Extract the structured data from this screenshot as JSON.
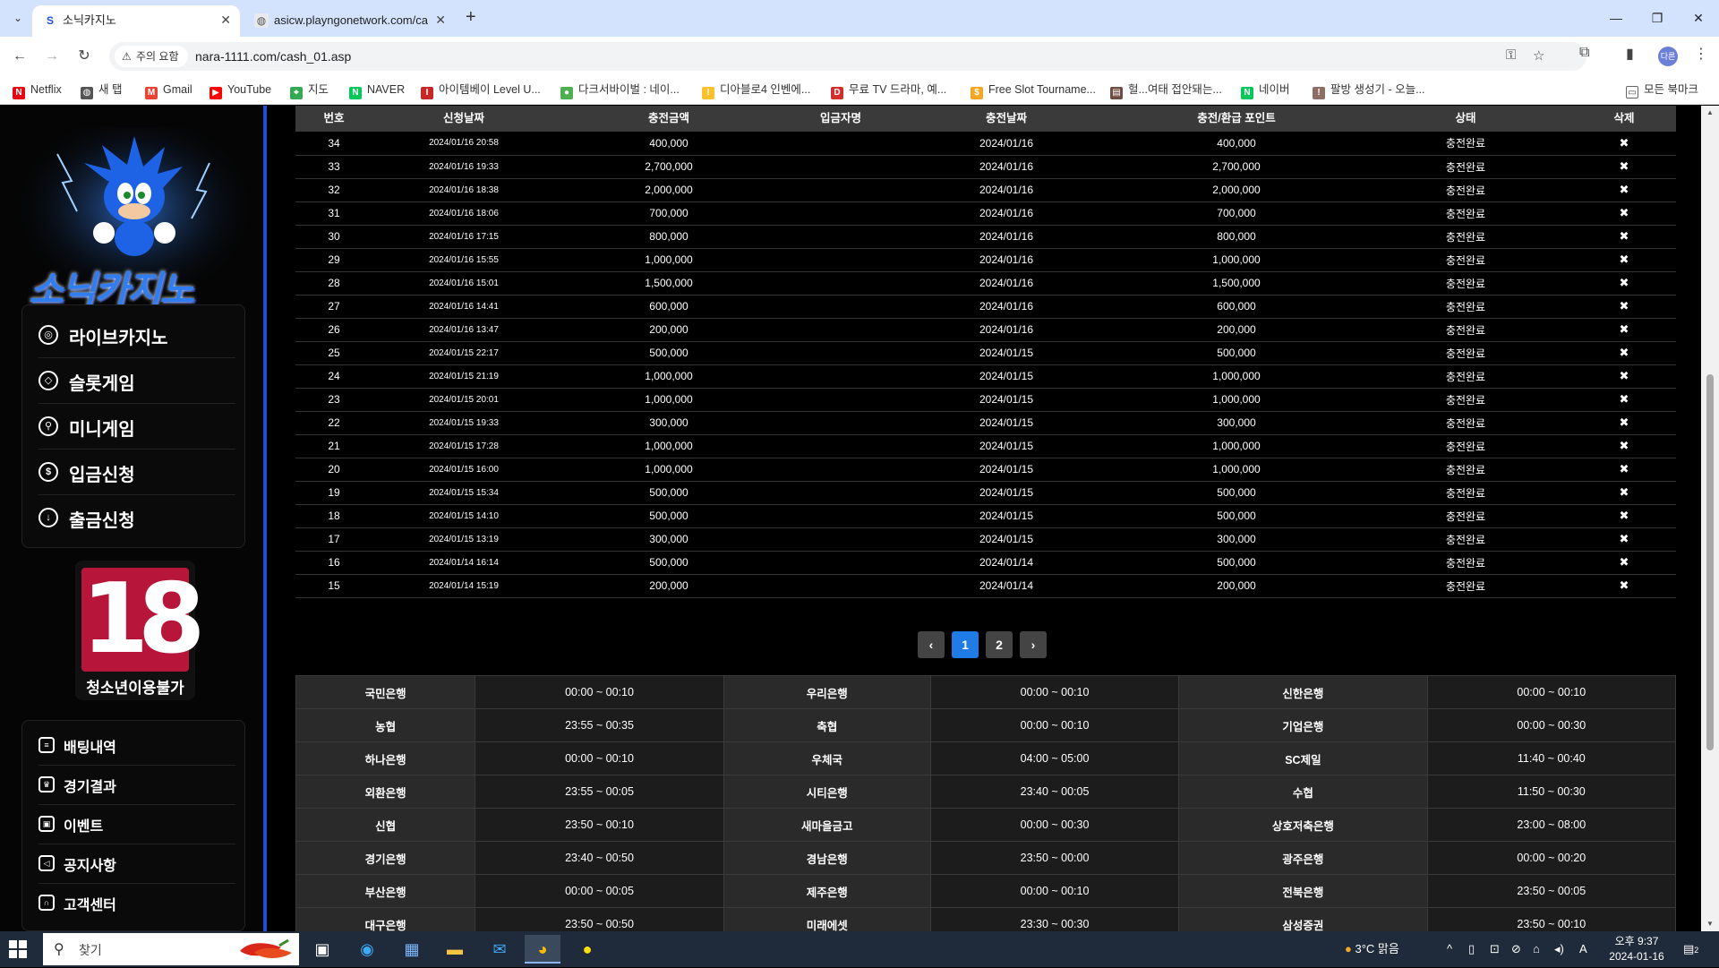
{
  "browser": {
    "tabs": [
      {
        "title": "소닉카지노",
        "active": true
      },
      {
        "title": "asicw.playngonetwork.com/ca",
        "active": false
      }
    ],
    "url": "nara-1111.com/cash_01.asp",
    "security_warning": "주의 요함",
    "bookmarks": [
      "Netflix",
      "새 탭",
      "Gmail",
      "YouTube",
      "지도",
      "NAVER",
      "아이템베이 Level U...",
      "다크서바이벌 : 네이...",
      "디아블로4 인벤에...",
      "무료 TV 드라마, 예...",
      "Free Slot Tourname...",
      "헐...여태 접안돼는...",
      "네이버",
      "팔방 생성기 - 오늘...",
      "모든 북마크"
    ],
    "profile_label": "다른"
  },
  "sidebar": {
    "logo_text": "소닉카지노",
    "main_menu": [
      {
        "label": "라이브카지노",
        "icon": "casino-chip-icon"
      },
      {
        "label": "슬롯게임",
        "icon": "diamond-icon"
      },
      {
        "label": "미니게임",
        "icon": "joystick-icon"
      },
      {
        "label": "입금신청",
        "icon": "dollar-icon"
      },
      {
        "label": "출금신청",
        "icon": "download-icon"
      }
    ],
    "age_badge": "18",
    "age_text": "청소년이용불가",
    "sub_menu": [
      {
        "label": "배팅내역",
        "icon": "list-icon"
      },
      {
        "label": "경기결과",
        "icon": "trophy-icon"
      },
      {
        "label": "이벤트",
        "icon": "gift-icon"
      },
      {
        "label": "공지사항",
        "icon": "megaphone-icon"
      },
      {
        "label": "고객센터",
        "icon": "headset-icon"
      }
    ]
  },
  "history": {
    "headers": [
      "번호",
      "신청날짜",
      "충전금액",
      "입금자명",
      "충전날짜",
      "충전/환급 포인트",
      "상태",
      "삭제"
    ],
    "rows": [
      [
        "34",
        "2024/01/16 20:58",
        "400,000",
        "",
        "2024/01/16",
        "400,000",
        "충전완료",
        "✖"
      ],
      [
        "33",
        "2024/01/16 19:33",
        "2,700,000",
        "",
        "2024/01/16",
        "2,700,000",
        "충전완료",
        "✖"
      ],
      [
        "32",
        "2024/01/16 18:38",
        "2,000,000",
        "",
        "2024/01/16",
        "2,000,000",
        "충전완료",
        "✖"
      ],
      [
        "31",
        "2024/01/16 18:06",
        "700,000",
        "",
        "2024/01/16",
        "700,000",
        "충전완료",
        "✖"
      ],
      [
        "30",
        "2024/01/16 17:15",
        "800,000",
        "",
        "2024/01/16",
        "800,000",
        "충전완료",
        "✖"
      ],
      [
        "29",
        "2024/01/16 15:55",
        "1,000,000",
        "",
        "2024/01/16",
        "1,000,000",
        "충전완료",
        "✖"
      ],
      [
        "28",
        "2024/01/16 15:01",
        "1,500,000",
        "",
        "2024/01/16",
        "1,500,000",
        "충전완료",
        "✖"
      ],
      [
        "27",
        "2024/01/16 14:41",
        "600,000",
        "",
        "2024/01/16",
        "600,000",
        "충전완료",
        "✖"
      ],
      [
        "26",
        "2024/01/16 13:47",
        "200,000",
        "",
        "2024/01/16",
        "200,000",
        "충전완료",
        "✖"
      ],
      [
        "25",
        "2024/01/15 22:17",
        "500,000",
        "",
        "2024/01/15",
        "500,000",
        "충전완료",
        "✖"
      ],
      [
        "24",
        "2024/01/15 21:19",
        "1,000,000",
        "",
        "2024/01/15",
        "1,000,000",
        "충전완료",
        "✖"
      ],
      [
        "23",
        "2024/01/15 20:01",
        "1,000,000",
        "",
        "2024/01/15",
        "1,000,000",
        "충전완료",
        "✖"
      ],
      [
        "22",
        "2024/01/15 19:33",
        "300,000",
        "",
        "2024/01/15",
        "300,000",
        "충전완료",
        "✖"
      ],
      [
        "21",
        "2024/01/15 17:28",
        "1,000,000",
        "",
        "2024/01/15",
        "1,000,000",
        "충전완료",
        "✖"
      ],
      [
        "20",
        "2024/01/15 16:00",
        "1,000,000",
        "",
        "2024/01/15",
        "1,000,000",
        "충전완료",
        "✖"
      ],
      [
        "19",
        "2024/01/15 15:34",
        "500,000",
        "",
        "2024/01/15",
        "500,000",
        "충전완료",
        "✖"
      ],
      [
        "18",
        "2024/01/15 14:10",
        "500,000",
        "",
        "2024/01/15",
        "500,000",
        "충전완료",
        "✖"
      ],
      [
        "17",
        "2024/01/15 13:19",
        "300,000",
        "",
        "2024/01/15",
        "300,000",
        "충전완료",
        "✖"
      ],
      [
        "16",
        "2024/01/14 16:14",
        "500,000",
        "",
        "2024/01/14",
        "500,000",
        "충전완료",
        "✖"
      ],
      [
        "15",
        "2024/01/14 15:19",
        "200,000",
        "",
        "2024/01/14",
        "200,000",
        "충전완료",
        "✖"
      ]
    ]
  },
  "pagination": {
    "prev": "‹",
    "pages": [
      "1",
      "2"
    ],
    "current": "1",
    "next": "›"
  },
  "banks": [
    [
      "국민은행",
      "00:00 ~ 00:10",
      "우리은행",
      "00:00 ~ 00:10",
      "신한은행",
      "00:00 ~ 00:10"
    ],
    [
      "농협",
      "23:55 ~ 00:35",
      "축협",
      "00:00 ~ 00:10",
      "기업은행",
      "00:00 ~ 00:30"
    ],
    [
      "하나은행",
      "00:00 ~ 00:10",
      "우체국",
      "04:00 ~ 05:00",
      "SC제일",
      "11:40 ~ 00:40"
    ],
    [
      "외환은행",
      "23:55 ~ 00:05",
      "시티은행",
      "23:40 ~ 00:05",
      "수협",
      "11:50 ~ 00:30"
    ],
    [
      "신협",
      "23:50 ~ 00:10",
      "새마을금고",
      "00:00 ~ 00:30",
      "상호저축은행",
      "23:00 ~ 08:00"
    ],
    [
      "경기은행",
      "23:40 ~ 00:50",
      "경남은행",
      "23:50 ~ 00:00",
      "광주은행",
      "00:00 ~ 00:20"
    ],
    [
      "부산은행",
      "00:00 ~ 00:05",
      "제주은행",
      "00:00 ~ 00:10",
      "전북은행",
      "23:50 ~ 00:05"
    ],
    [
      "대구은행",
      "23:50 ~ 00:50",
      "미래에셋",
      "23:30 ~ 00:30",
      "삼성증권",
      "23:50 ~ 00:10"
    ]
  ],
  "taskbar": {
    "search_placeholder": "찾기",
    "weather": "3°C 맑음",
    "time": "오후 9:37",
    "date": "2024-01-16",
    "notification_count": "2"
  }
}
